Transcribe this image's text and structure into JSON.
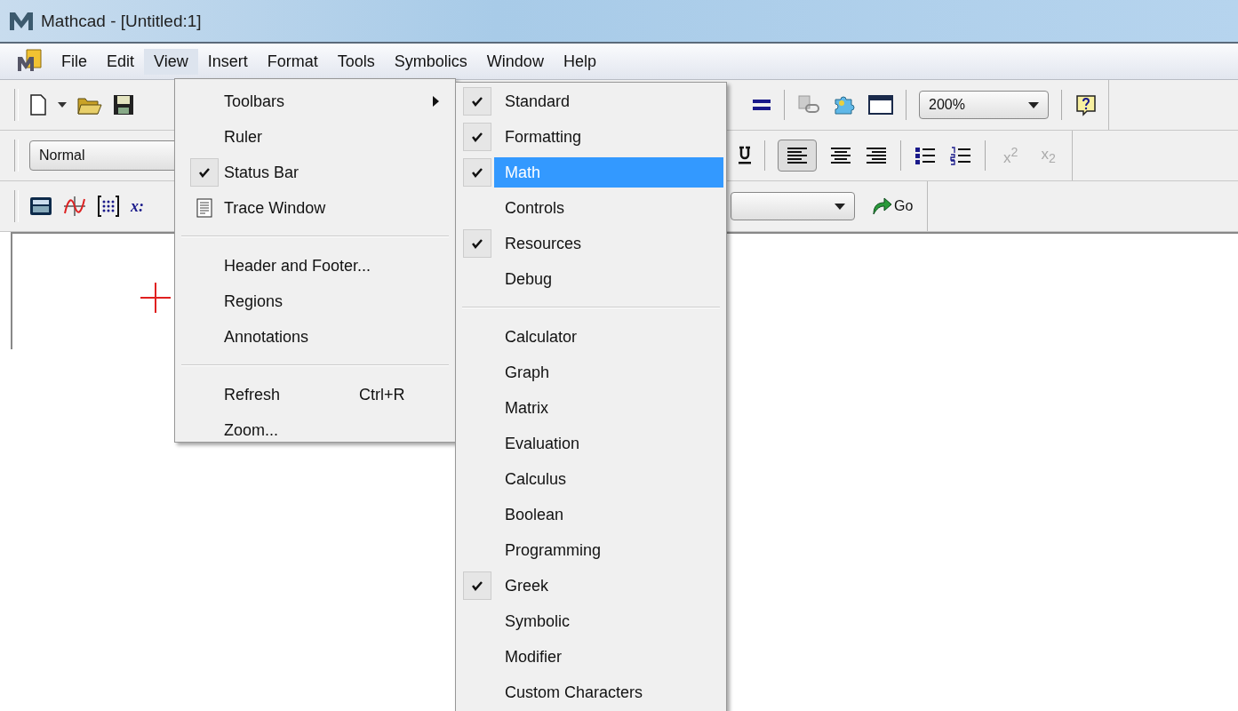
{
  "window": {
    "title": "Mathcad - [Untitled:1]"
  },
  "menu_bar": [
    {
      "label": "File",
      "selected": false
    },
    {
      "label": "Edit",
      "selected": false
    },
    {
      "label": "View",
      "selected": true
    },
    {
      "label": "Insert",
      "selected": false
    },
    {
      "label": "Format",
      "selected": false
    },
    {
      "label": "Tools",
      "selected": false
    },
    {
      "label": "Symbolics",
      "selected": false
    },
    {
      "label": "Window",
      "selected": false
    },
    {
      "label": "Help",
      "selected": false
    }
  ],
  "standard_toolbar": {
    "zoom": "200%"
  },
  "formatting_toolbar": {
    "style": "Normal",
    "superscript": {
      "label": "x$^{2}$",
      "disabled": true
    },
    "subscript": {
      "label": "x$_{2}$",
      "disabled": true
    }
  },
  "math_toolbar": {
    "partial_label": "x:",
    "go": "Go"
  },
  "view_menu": [
    {
      "kind": "item",
      "label": "Toolbars",
      "checked": false,
      "submenu": true
    },
    {
      "kind": "item",
      "label": "Ruler",
      "checked": false
    },
    {
      "kind": "item",
      "label": "Status Bar",
      "checked": true
    },
    {
      "kind": "icon_item",
      "label": "Trace Window",
      "checked": false
    },
    {
      "kind": "separator"
    },
    {
      "kind": "item",
      "label": "Header and Footer...",
      "checked": false
    },
    {
      "kind": "item",
      "label": "Regions",
      "checked": false
    },
    {
      "kind": "item",
      "label": "Annotations",
      "checked": false
    },
    {
      "kind": "separator"
    },
    {
      "kind": "item",
      "label": "Refresh",
      "checked": false,
      "shortcut": "Ctrl+R"
    },
    {
      "kind": "item",
      "label": "Zoom...",
      "checked": false
    }
  ],
  "toolbars_submenu": [
    {
      "kind": "item",
      "label": "Standard",
      "checked": true,
      "selected": false
    },
    {
      "kind": "item",
      "label": "Formatting",
      "checked": true,
      "selected": false
    },
    {
      "kind": "item",
      "label": "Math",
      "checked": true,
      "selected": true
    },
    {
      "kind": "item",
      "label": "Controls",
      "checked": false,
      "selected": false
    },
    {
      "kind": "item",
      "label": "Resources",
      "checked": true,
      "selected": false
    },
    {
      "kind": "item",
      "label": "Debug",
      "checked": false,
      "selected": false
    },
    {
      "kind": "separator"
    },
    {
      "kind": "item",
      "label": "Calculator",
      "checked": false,
      "selected": false
    },
    {
      "kind": "item",
      "label": "Graph",
      "checked": false,
      "selected": false
    },
    {
      "kind": "item",
      "label": "Matrix",
      "checked": false,
      "selected": false
    },
    {
      "kind": "item",
      "label": "Evaluation",
      "checked": false,
      "selected": false
    },
    {
      "kind": "item",
      "label": "Calculus",
      "checked": false,
      "selected": false
    },
    {
      "kind": "item",
      "label": "Boolean",
      "checked": false,
      "selected": false
    },
    {
      "kind": "item",
      "label": "Programming",
      "checked": false,
      "selected": false
    },
    {
      "kind": "item",
      "label": "Greek",
      "checked": true,
      "selected": false
    },
    {
      "kind": "item",
      "label": "Symbolic",
      "checked": false,
      "selected": false
    },
    {
      "kind": "item",
      "label": "Modifier",
      "checked": false,
      "selected": false
    },
    {
      "kind": "item",
      "label": "Custom Characters",
      "checked": false,
      "selected": false
    }
  ]
}
